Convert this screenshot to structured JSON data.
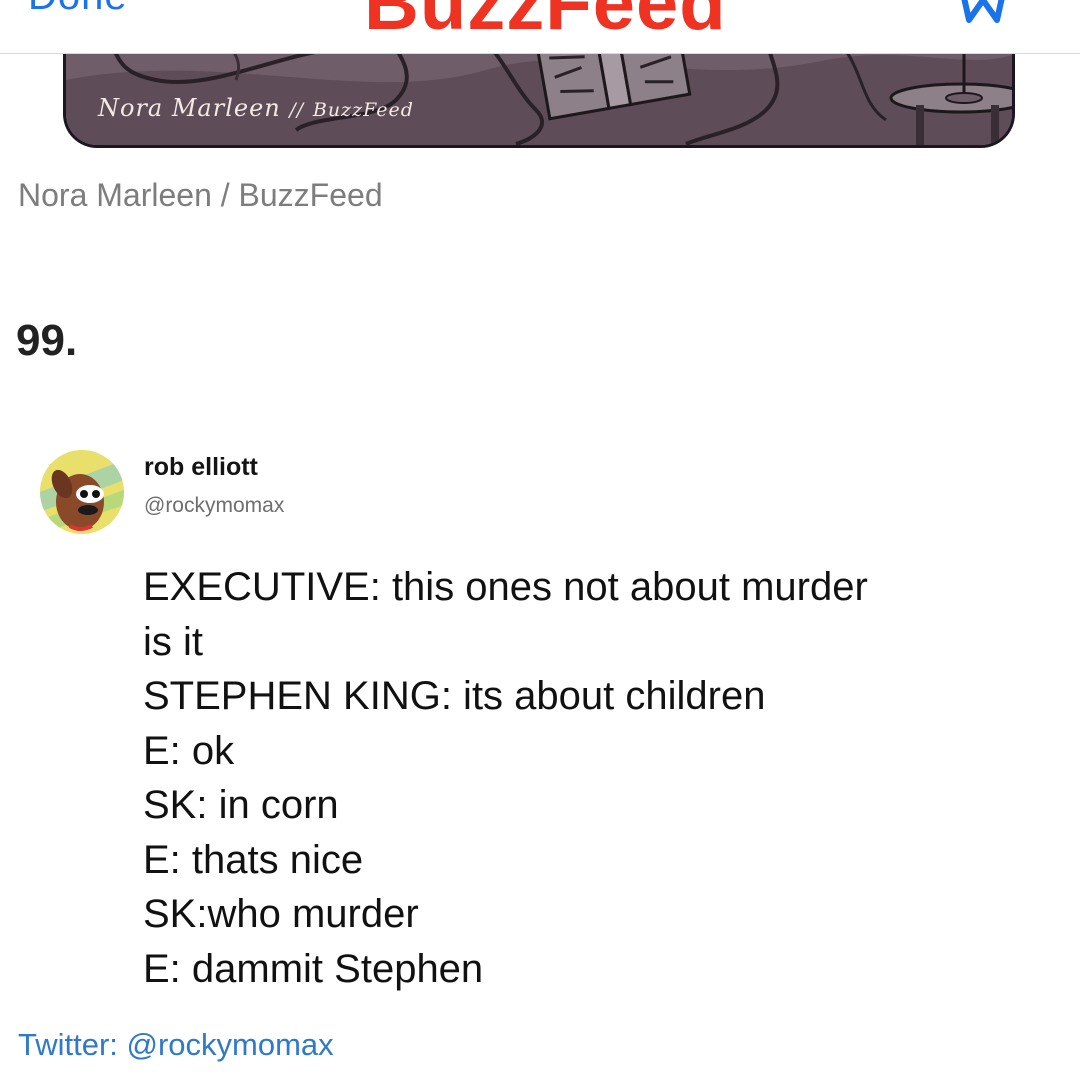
{
  "navbar": {
    "done_label": "Done",
    "logo_text": "BuzzFeed",
    "bookmark_icon": "bookmark-icon"
  },
  "comic": {
    "signature_author": "Nora Marleen",
    "signature_separator": "//",
    "signature_site": "BuzzFeed"
  },
  "caption": "Nora Marleen / BuzzFeed",
  "item_number": "99.",
  "tweet": {
    "author_name": "rob elliott",
    "author_handle": "@rockymomax",
    "avatar_icon": "dog-avatar",
    "lines": [
      "EXECUTIVE: this ones not about murder",
      "is it",
      "STEPHEN KING: its about children",
      "E: ok",
      "SK: in corn",
      "E: thats nice",
      "SK:who murder",
      "E: dammit Stephen"
    ]
  },
  "source_link": "Twitter: @rockymomax",
  "colors": {
    "link_blue": "#1a73e8",
    "brand_red": "#ee3322",
    "source_blue": "#2f79c9"
  }
}
